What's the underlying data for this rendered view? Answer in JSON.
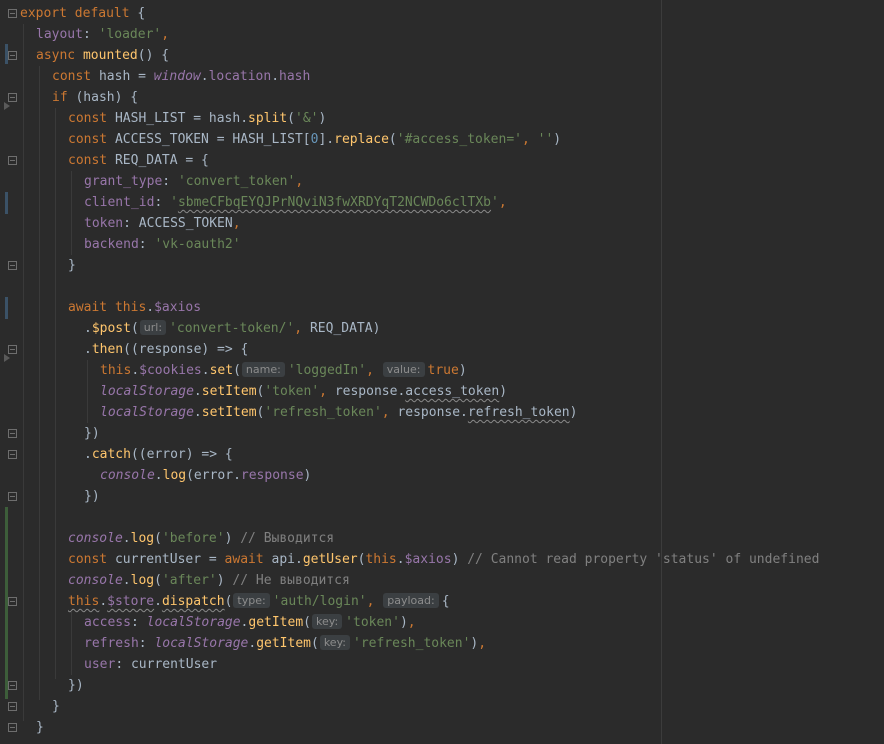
{
  "editor": {
    "lines": [
      {
        "indent": 0,
        "tokens": [
          {
            "t": "export default ",
            "c": "kw"
          },
          {
            "t": "{"
          }
        ]
      },
      {
        "indent": 1,
        "tokens": [
          {
            "t": "layout",
            "c": "prop"
          },
          {
            "t": ": "
          },
          {
            "t": "'loader'",
            "c": "str"
          },
          {
            "t": ",",
            "c": "kw"
          }
        ]
      },
      {
        "indent": 1,
        "tokens": [
          {
            "t": "async ",
            "c": "kw"
          },
          {
            "t": "mounted",
            "c": "fn"
          },
          {
            "t": "() {"
          }
        ]
      },
      {
        "indent": 2,
        "tokens": [
          {
            "t": "const ",
            "c": "kw"
          },
          {
            "t": "hash = "
          },
          {
            "t": "window",
            "c": "glob"
          },
          {
            "t": "."
          },
          {
            "t": "location",
            "c": "prop"
          },
          {
            "t": "."
          },
          {
            "t": "hash",
            "c": "prop"
          }
        ]
      },
      {
        "indent": 2,
        "tokens": [
          {
            "t": "if ",
            "c": "kw"
          },
          {
            "t": "(hash) {"
          }
        ]
      },
      {
        "indent": 3,
        "tokens": [
          {
            "t": "const ",
            "c": "kw"
          },
          {
            "t": "HASH_LIST = hash."
          },
          {
            "t": "split",
            "c": "fn"
          },
          {
            "t": "("
          },
          {
            "t": "'&'",
            "c": "str"
          },
          {
            "t": ")"
          }
        ]
      },
      {
        "indent": 3,
        "tokens": [
          {
            "t": "const ",
            "c": "kw"
          },
          {
            "t": "ACCESS_TOKEN = HASH_LIST["
          },
          {
            "t": "0",
            "c": "num"
          },
          {
            "t": "]."
          },
          {
            "t": "replace",
            "c": "fn"
          },
          {
            "t": "("
          },
          {
            "t": "'#access_token='",
            "c": "str"
          },
          {
            "t": ", ",
            "c": "kw"
          },
          {
            "t": "''",
            "c": "str"
          },
          {
            "t": ")"
          }
        ]
      },
      {
        "indent": 3,
        "tokens": [
          {
            "t": "const ",
            "c": "kw"
          },
          {
            "t": "REQ_DATA = {"
          }
        ]
      },
      {
        "indent": 4,
        "tokens": [
          {
            "t": "grant_type",
            "c": "prop"
          },
          {
            "t": ": "
          },
          {
            "t": "'convert_token'",
            "c": "str"
          },
          {
            "t": ",",
            "c": "kw"
          }
        ]
      },
      {
        "indent": 4,
        "tokens": [
          {
            "t": "client_id",
            "c": "prop"
          },
          {
            "t": ": "
          },
          {
            "t": "'",
            "c": "str"
          },
          {
            "t": "sbmeCFbqEYQJPrNQviN3fwXRDYqT2NCWDo6clTXb",
            "c": "str wavy"
          },
          {
            "t": "'",
            "c": "str"
          },
          {
            "t": ",",
            "c": "kw"
          }
        ]
      },
      {
        "indent": 4,
        "tokens": [
          {
            "t": "token",
            "c": "prop"
          },
          {
            "t": ": ACCESS_TOKEN"
          },
          {
            "t": ",",
            "c": "kw"
          }
        ]
      },
      {
        "indent": 4,
        "tokens": [
          {
            "t": "backend",
            "c": "prop"
          },
          {
            "t": ": "
          },
          {
            "t": "'vk-oauth2'",
            "c": "str"
          }
        ]
      },
      {
        "indent": 3,
        "tokens": [
          {
            "t": "}"
          }
        ]
      },
      {
        "indent": 0,
        "tokens": []
      },
      {
        "indent": 3,
        "tokens": [
          {
            "t": "await ",
            "c": "kw"
          },
          {
            "t": "this",
            "c": "kw"
          },
          {
            "t": "."
          },
          {
            "t": "$axios",
            "c": "prop"
          }
        ]
      },
      {
        "indent": 4,
        "tokens": [
          {
            "t": "."
          },
          {
            "t": "$post",
            "c": "fn"
          },
          {
            "t": "("
          },
          {
            "t": "url:",
            "c": "hint"
          },
          {
            "t": "'convert-token/'",
            "c": "str"
          },
          {
            "t": ", ",
            "c": "kw"
          },
          {
            "t": "REQ_DATA)"
          }
        ]
      },
      {
        "indent": 4,
        "tokens": [
          {
            "t": "."
          },
          {
            "t": "then",
            "c": "fn"
          },
          {
            "t": "((response) => {"
          }
        ]
      },
      {
        "indent": 5,
        "tokens": [
          {
            "t": "this",
            "c": "kw"
          },
          {
            "t": "."
          },
          {
            "t": "$cookies",
            "c": "prop"
          },
          {
            "t": "."
          },
          {
            "t": "set",
            "c": "fn"
          },
          {
            "t": "("
          },
          {
            "t": "name:",
            "c": "hint"
          },
          {
            "t": "'loggedIn'",
            "c": "str"
          },
          {
            "t": ", ",
            "c": "kw"
          },
          {
            "t": "value:",
            "c": "hint"
          },
          {
            "t": "true",
            "c": "kw"
          },
          {
            "t": ")"
          }
        ]
      },
      {
        "indent": 5,
        "tokens": [
          {
            "t": "localStorage",
            "c": "glob"
          },
          {
            "t": "."
          },
          {
            "t": "setItem",
            "c": "fn"
          },
          {
            "t": "("
          },
          {
            "t": "'token'",
            "c": "str"
          },
          {
            "t": ", ",
            "c": "kw"
          },
          {
            "t": "response."
          },
          {
            "t": "access_token",
            "c": "wavy"
          },
          {
            "t": ")"
          }
        ]
      },
      {
        "indent": 5,
        "tokens": [
          {
            "t": "localStorage",
            "c": "glob"
          },
          {
            "t": "."
          },
          {
            "t": "setItem",
            "c": "fn"
          },
          {
            "t": "("
          },
          {
            "t": "'refresh_token'",
            "c": "str"
          },
          {
            "t": ", ",
            "c": "kw"
          },
          {
            "t": "response."
          },
          {
            "t": "refresh_token",
            "c": "wavy"
          },
          {
            "t": ")"
          }
        ]
      },
      {
        "indent": 4,
        "tokens": [
          {
            "t": "})"
          }
        ]
      },
      {
        "indent": 4,
        "tokens": [
          {
            "t": "."
          },
          {
            "t": "catch",
            "c": "fn"
          },
          {
            "t": "((error) => {"
          }
        ]
      },
      {
        "indent": 5,
        "tokens": [
          {
            "t": "console",
            "c": "glob"
          },
          {
            "t": "."
          },
          {
            "t": "log",
            "c": "fn"
          },
          {
            "t": "(error."
          },
          {
            "t": "response",
            "c": "prop"
          },
          {
            "t": ")"
          }
        ]
      },
      {
        "indent": 4,
        "tokens": [
          {
            "t": "})"
          }
        ]
      },
      {
        "indent": 0,
        "tokens": []
      },
      {
        "indent": 3,
        "tokens": [
          {
            "t": "console",
            "c": "glob"
          },
          {
            "t": "."
          },
          {
            "t": "log",
            "c": "fn"
          },
          {
            "t": "("
          },
          {
            "t": "'before'",
            "c": "str"
          },
          {
            "t": ") "
          },
          {
            "t": "// Выводится",
            "c": "cmt"
          }
        ]
      },
      {
        "indent": 3,
        "tokens": [
          {
            "t": "const ",
            "c": "kw"
          },
          {
            "t": "currentUser = "
          },
          {
            "t": "await ",
            "c": "kw"
          },
          {
            "t": "api."
          },
          {
            "t": "getUser",
            "c": "fn"
          },
          {
            "t": "("
          },
          {
            "t": "this",
            "c": "kw"
          },
          {
            "t": "."
          },
          {
            "t": "$axios",
            "c": "prop"
          },
          {
            "t": ") "
          },
          {
            "t": "// Cannot read property 'status' of undefined",
            "c": "cmt"
          }
        ]
      },
      {
        "indent": 3,
        "tokens": [
          {
            "t": "console",
            "c": "glob"
          },
          {
            "t": "."
          },
          {
            "t": "log",
            "c": "fn"
          },
          {
            "t": "("
          },
          {
            "t": "'after'",
            "c": "str"
          },
          {
            "t": ") "
          },
          {
            "t": "// Не выводится",
            "c": "cmt"
          }
        ]
      },
      {
        "indent": 3,
        "tokens": [
          {
            "t": "this",
            "c": "kw wavy"
          },
          {
            "t": "."
          },
          {
            "t": "$store",
            "c": "prop wavy"
          },
          {
            "t": "."
          },
          {
            "t": "dispatch",
            "c": "fn wavy"
          },
          {
            "t": "("
          },
          {
            "t": "type:",
            "c": "hint"
          },
          {
            "t": "'auth/login'",
            "c": "str"
          },
          {
            "t": ", ",
            "c": "kw"
          },
          {
            "t": "payload:",
            "c": "hint"
          },
          {
            "t": "{"
          }
        ]
      },
      {
        "indent": 4,
        "tokens": [
          {
            "t": "access",
            "c": "prop"
          },
          {
            "t": ": "
          },
          {
            "t": "localStorage",
            "c": "glob"
          },
          {
            "t": "."
          },
          {
            "t": "getItem",
            "c": "fn"
          },
          {
            "t": "("
          },
          {
            "t": "key:",
            "c": "hint"
          },
          {
            "t": "'token'",
            "c": "str"
          },
          {
            "t": ")"
          },
          {
            "t": ",",
            "c": "kw"
          }
        ]
      },
      {
        "indent": 4,
        "tokens": [
          {
            "t": "refresh",
            "c": "prop"
          },
          {
            "t": ": "
          },
          {
            "t": "localStorage",
            "c": "glob"
          },
          {
            "t": "."
          },
          {
            "t": "getItem",
            "c": "fn"
          },
          {
            "t": "("
          },
          {
            "t": "key:",
            "c": "hint"
          },
          {
            "t": "'refresh_token'",
            "c": "str"
          },
          {
            "t": ")"
          },
          {
            "t": ",",
            "c": "kw"
          }
        ]
      },
      {
        "indent": 4,
        "tokens": [
          {
            "t": "user",
            "c": "prop"
          },
          {
            "t": ": currentUser"
          }
        ]
      },
      {
        "indent": 3,
        "tokens": [
          {
            "t": "})"
          }
        ]
      },
      {
        "indent": 2,
        "tokens": [
          {
            "t": "}"
          }
        ]
      },
      {
        "indent": 1,
        "tokens": [
          {
            "t": "}"
          }
        ]
      }
    ]
  },
  "theme": {
    "background": "#2b2b2b",
    "keyword": "#cc7832",
    "string": "#6a8759",
    "property": "#9876aa",
    "function": "#ffc66d",
    "comment": "#808080",
    "number": "#6897bb",
    "text": "#a9b7c6",
    "change_marker_modified": "#3b5267",
    "change_marker_added": "#3d5e3a"
  }
}
